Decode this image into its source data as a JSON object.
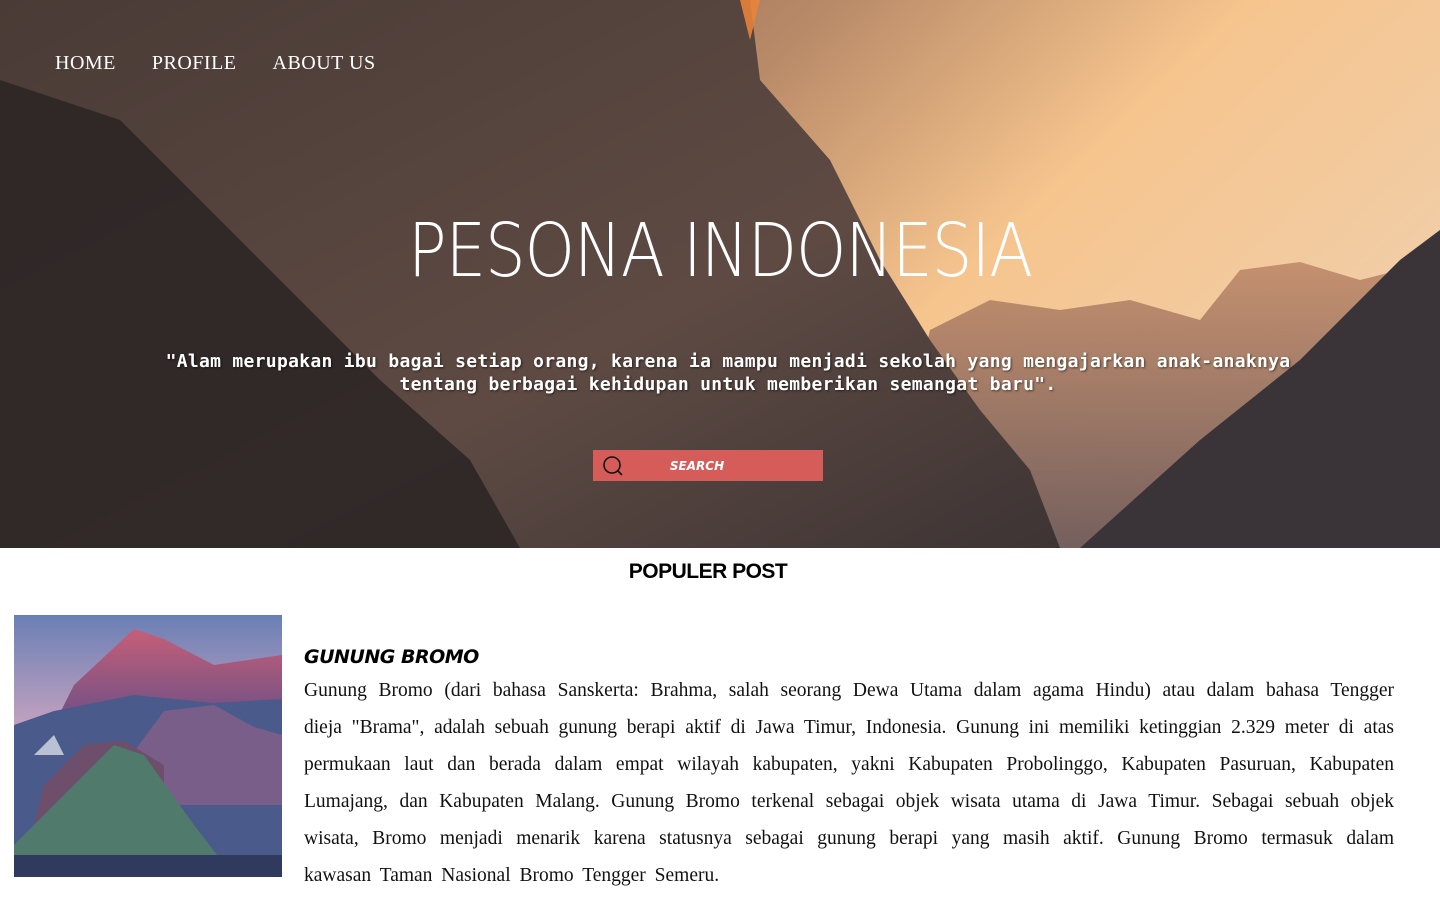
{
  "nav": {
    "items": [
      {
        "label": "HOME"
      },
      {
        "label": "PROFILE"
      },
      {
        "label": "ABOUT  US"
      }
    ]
  },
  "hero": {
    "title": "PESONA INDONESIA",
    "quote": "\"Alam merupakan ibu bagai setiap orang, karena ia mampu menjadi sekolah yang mengajarkan anak-anaknya tentang berbagai kehidupan untuk memberikan semangat baru\"."
  },
  "search": {
    "placeholder": "SEARCH",
    "icon": "search-icon",
    "background_color": "#d65c5a"
  },
  "popular": {
    "section_title": "POPULER POST",
    "posts": [
      {
        "title": "GUNUNG BROMO",
        "body": "Gunung Bromo (dari bahasa Sanskerta: Brahma, salah seorang Dewa Utama dalam agama Hindu) atau dalam bahasa Tengger dieja \"Brama\", adalah sebuah gunung berapi aktif di Jawa Timur, Indonesia. Gunung ini memiliki ketinggian 2.329 meter di atas permukaan laut dan berada dalam empat wilayah kabupaten, yakni Kabupaten Probolinggo, Kabupaten Pasuruan, Kabupaten Lumajang, dan Kabupaten Malang. Gunung Bromo terkenal sebagai objek wisata utama di Jawa Timur. Sebagai sebuah objek wisata, Bromo menjadi menarik karena statusnya sebagai gunung berapi yang masih aktif. Gunung Bromo termasuk dalam kawasan Taman Nasional Bromo Tengger Semeru."
      }
    ]
  }
}
